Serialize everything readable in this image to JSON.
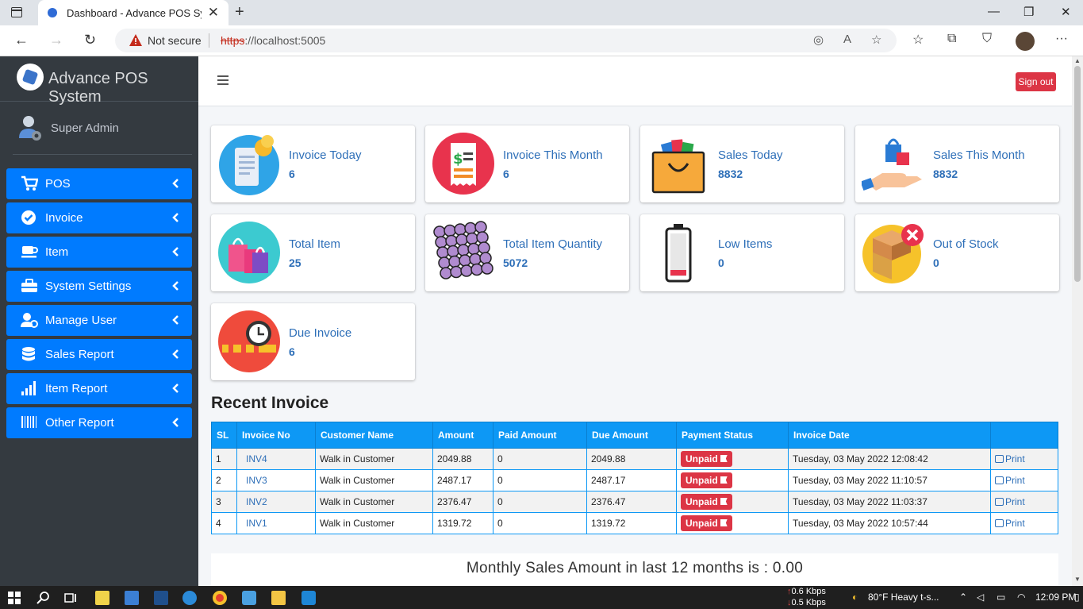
{
  "browser": {
    "tab_title": "Dashboard - Advance POS System",
    "security_label": "Not secure",
    "url_scheme": "https",
    "url_rest": "://localhost:5005"
  },
  "sidebar": {
    "brand": "Advance POS System",
    "user_name": "Super Admin",
    "items": [
      {
        "label": "POS",
        "icon": "cart-icon"
      },
      {
        "label": "Invoice",
        "icon": "check-circle-icon"
      },
      {
        "label": "Item",
        "icon": "cup-icon"
      },
      {
        "label": "System Settings",
        "icon": "toolbox-icon"
      },
      {
        "label": "Manage User",
        "icon": "user-gear-icon"
      },
      {
        "label": "Sales Report",
        "icon": "database-icon"
      },
      {
        "label": "Item Report",
        "icon": "signal-bars-icon"
      },
      {
        "label": "Other Report",
        "icon": "barcode-icon"
      }
    ]
  },
  "header": {
    "signout_label": "Sign out"
  },
  "cards": [
    {
      "title": "Invoice Today",
      "value": "6",
      "icon": "receipt-coins-icon"
    },
    {
      "title": "Invoice This Month",
      "value": "6",
      "icon": "bill-icon"
    },
    {
      "title": "Sales Today",
      "value": "8832",
      "icon": "shopping-bag-icon"
    },
    {
      "title": "Sales This Month",
      "value": "8832",
      "icon": "hand-bag-icon"
    },
    {
      "title": "Total Item",
      "value": "25",
      "icon": "shopping-bags-icon"
    },
    {
      "title": "Total Item Quantity",
      "value": "5072",
      "icon": "stacked-spheres-icon"
    },
    {
      "title": "Low Items",
      "value": "0",
      "icon": "low-battery-icon"
    },
    {
      "title": "Out of Stock",
      "value": "0",
      "icon": "box-cross-icon"
    },
    {
      "title": "Due Invoice",
      "value": "6",
      "icon": "clock-tape-icon"
    }
  ],
  "recent_invoice": {
    "heading": "Recent Invoice",
    "columns": [
      "SL",
      "Invoice No",
      "Customer Name",
      "Amount",
      "Paid Amount",
      "Due Amount",
      "Payment Status",
      "Invoice Date",
      ""
    ],
    "rows": [
      {
        "sl": "1",
        "invoice_no": "INV4",
        "customer": "Walk in Customer",
        "amount": "2049.88",
        "paid": "0",
        "due": "2049.88",
        "status": "Unpaid",
        "date": "Tuesday, 03 May 2022 12:08:42",
        "action": "Print"
      },
      {
        "sl": "2",
        "invoice_no": "INV3",
        "customer": "Walk in Customer",
        "amount": "2487.17",
        "paid": "0",
        "due": "2487.17",
        "status": "Unpaid",
        "date": "Tuesday, 03 May 2022 11:10:57",
        "action": "Print"
      },
      {
        "sl": "3",
        "invoice_no": "INV2",
        "customer": "Walk in Customer",
        "amount": "2376.47",
        "paid": "0",
        "due": "2376.47",
        "status": "Unpaid",
        "date": "Tuesday, 03 May 2022 11:03:37",
        "action": "Print"
      },
      {
        "sl": "4",
        "invoice_no": "INV1",
        "customer": "Walk in Customer",
        "amount": "1319.72",
        "paid": "0",
        "due": "1319.72",
        "status": "Unpaid",
        "date": "Tuesday, 03 May 2022 10:57:44",
        "action": "Print"
      }
    ]
  },
  "monthly_sales_text": "Monthly Sales Amount in last 12 months is : 0.00",
  "taskbar": {
    "net_up": "0.6 Kbps",
    "net_down": "0.5 Kbps",
    "weather": "80°F  Heavy t-s...",
    "clock": "12:09 PM"
  },
  "colors": {
    "sidebar_bg": "#343a40",
    "menu_item": "#007bff",
    "table_header": "#0d98f5",
    "unpaid": "#dc3545",
    "link": "#2e6fb8"
  }
}
